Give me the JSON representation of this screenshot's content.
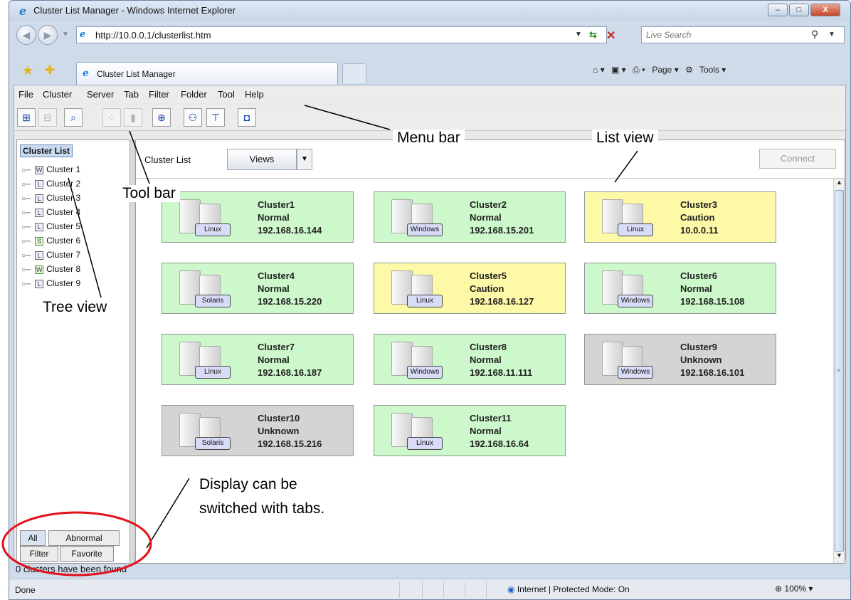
{
  "window": {
    "title": "Cluster List Manager - Windows Internet Explorer",
    "min": "–",
    "max": "□",
    "close": "X"
  },
  "address": {
    "url": "http://10.0.0.1/clusterlist.htm",
    "search_placeholder": "Live Search"
  },
  "tabs": {
    "active_title": "Cluster List Manager"
  },
  "commandbar": {
    "page": "Page ▾",
    "tools": "Tools ▾"
  },
  "menu": [
    "File",
    "Cluster",
    "Server",
    "Tab",
    "Filter",
    "Folder",
    "Tool",
    "Help"
  ],
  "tree": {
    "root": "Cluster List",
    "items": [
      {
        "label": "Cluster 1",
        "type": "W"
      },
      {
        "label": "Cluster 2",
        "type": "L"
      },
      {
        "label": "Cluster 3",
        "type": "L"
      },
      {
        "label": "Cluster 4",
        "type": "L"
      },
      {
        "label": "Cluster 5",
        "type": "L"
      },
      {
        "label": "Cluster 6",
        "type": "S"
      },
      {
        "label": "Cluster 7",
        "type": "L"
      },
      {
        "label": "Cluster 8",
        "type": "W"
      },
      {
        "label": "Cluster 9",
        "type": "L"
      }
    ],
    "tabs": [
      "All",
      "Abnormal",
      "Filter",
      "Favorite"
    ]
  },
  "listview": {
    "title": "Cluster List",
    "views_label": "Views",
    "connect_label": "Connect",
    "clusters": [
      {
        "name": "Cluster1",
        "status": "Normal",
        "ip": "192.168.16.144",
        "os": "Linux",
        "state": "normal"
      },
      {
        "name": "Cluster2",
        "status": "Normal",
        "ip": "192.168.15.201",
        "os": "Windows",
        "state": "normal"
      },
      {
        "name": "Cluster3",
        "status": "Caution",
        "ip": "10.0.0.11",
        "os": "Linux",
        "state": "caution"
      },
      {
        "name": "Cluster4",
        "status": "Normal",
        "ip": "192.168.15.220",
        "os": "Solaris",
        "state": "normal"
      },
      {
        "name": "Cluster5",
        "status": "Caution",
        "ip": "192.168.16.127",
        "os": "Linux",
        "state": "caution"
      },
      {
        "name": "Cluster6",
        "status": "Normal",
        "ip": "192.168.15.108",
        "os": "Windows",
        "state": "normal"
      },
      {
        "name": "Cluster7",
        "status": "Normal",
        "ip": "192.168.16.187",
        "os": "Linux",
        "state": "normal"
      },
      {
        "name": "Cluster8",
        "status": "Normal",
        "ip": "192.168.11.111",
        "os": "Windows",
        "state": "normal"
      },
      {
        "name": "Cluster9",
        "status": "Unknown",
        "ip": "192.168.16.101",
        "os": "Windows",
        "state": "unknown"
      },
      {
        "name": "Cluster10",
        "status": "Unknown",
        "ip": "192.168.15.216",
        "os": "Solaris",
        "state": "unknown"
      },
      {
        "name": "Cluster11",
        "status": "Normal",
        "ip": "192.168.16.64",
        "os": "Linux",
        "state": "normal"
      }
    ]
  },
  "cluster_status_line": "0 clusters have been found",
  "statusbar": {
    "text": "Done",
    "zone": "Internet | Protected Mode: On",
    "zoom": "100%"
  },
  "annotations": {
    "menu_bar": "Menu bar",
    "list_view": "List view",
    "tool_bar": "Tool bar",
    "tree_view": "Tree view",
    "tabs_note_line1": "Display can be",
    "tabs_note_line2": "switched with tabs."
  },
  "colors": {
    "normal": "#cdf8cb",
    "caution": "#fdf9a6",
    "unknown": "#d4d4d4",
    "highlight_ring": "#e3121b"
  }
}
